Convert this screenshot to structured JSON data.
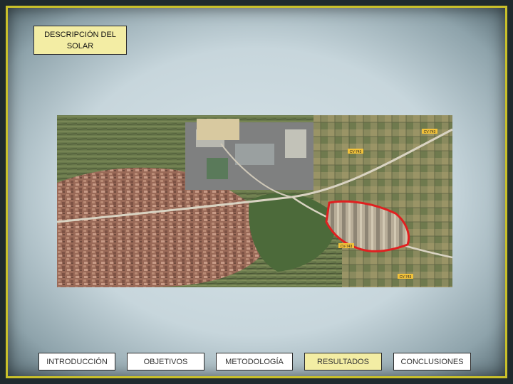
{
  "slide": {
    "title": "DESCRIPCIÓN DEL SOLAR"
  },
  "map": {
    "road_labels": [
      "CV-743",
      "CV-743",
      "CV-743",
      "CV-743"
    ]
  },
  "nav": {
    "items": [
      {
        "label": "INTRODUCCIÓN"
      },
      {
        "label": "OBJETIVOS"
      },
      {
        "label": "METODOLOGÍA"
      },
      {
        "label": "RESULTADOS"
      },
      {
        "label": "CONCLUSIONES"
      }
    ],
    "active_index": 3
  },
  "colors": {
    "frame_border": "#c9c02a",
    "highlight_box": "#f3eda4",
    "site_outline": "#e02020"
  }
}
